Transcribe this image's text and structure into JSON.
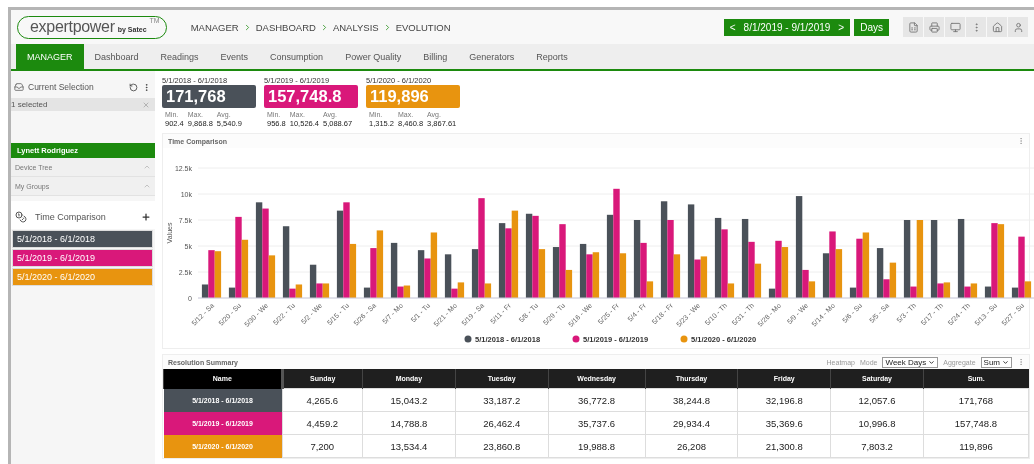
{
  "header": {
    "logo": {
      "name": "expertpower",
      "by": "by Satec",
      "tm": "TM"
    },
    "breadcrumb": [
      "MANAGER",
      "DASHBOARD",
      "ANALYSIS",
      "EVOLUTION"
    ],
    "date_range": {
      "prev": "<",
      "label": "8/1/2019 - 9/1/2019",
      "next": ">"
    },
    "resolution": "Days"
  },
  "tabs": [
    {
      "label": "MANAGER",
      "selected": true
    },
    {
      "label": "Dashboard",
      "selected": false
    },
    {
      "label": "Readings",
      "selected": false
    },
    {
      "label": "Events",
      "selected": false
    },
    {
      "label": "Consumption",
      "selected": false
    },
    {
      "label": "Power Quality",
      "selected": false
    },
    {
      "label": "Billing",
      "selected": false
    },
    {
      "label": "Generators",
      "selected": false
    },
    {
      "label": "Reports",
      "selected": false
    }
  ],
  "sidebar": {
    "current_selection": {
      "title": "Current Selection",
      "selected_text": "1 selected"
    },
    "user": "Lynett Rodriguez",
    "sections": [
      {
        "label": "Device Tree"
      },
      {
        "label": "My Groups"
      }
    ],
    "time_comparison": {
      "title": "Time Comparison",
      "periods": [
        {
          "label": "5/1/2018 - 6/1/2018",
          "color": "#4a5159"
        },
        {
          "label": "5/1/2019 - 6/1/2019",
          "color": "#d9187a"
        },
        {
          "label": "5/1/2020 - 6/1/2020",
          "color": "#e8940f"
        }
      ]
    }
  },
  "stats": [
    {
      "period": "5/1/2018 - 6/1/2018",
      "total": "171,768",
      "color": "#4a5159",
      "min_label": "Min.",
      "min": "902.4",
      "max_label": "Max.",
      "max": "9,868.8",
      "avg_label": "Avg.",
      "avg": "5,540.9"
    },
    {
      "period": "5/1/2019 - 6/1/2019",
      "total": "157,748.8",
      "color": "#d9187a",
      "min_label": "Min.",
      "min": "956.8",
      "max_label": "Max.",
      "max": "10,526.4",
      "avg_label": "Avg.",
      "avg": "5,088.67"
    },
    {
      "period": "5/1/2020 - 6/1/2020",
      "total": "119,896",
      "color": "#e8940f",
      "min_label": "Min.",
      "min": "1,315.2",
      "max_label": "Max.",
      "max": "8,460.8",
      "avg_label": "Avg.",
      "avg": "3,867.61"
    }
  ],
  "chart_panel": {
    "title": "Time Comparison",
    "chart_data": {
      "type": "bar",
      "ylabel": "Values",
      "ylim": [
        0,
        12500
      ],
      "grid": true,
      "legend": true,
      "yticks": [
        {
          "value": 0,
          "label": "0"
        },
        {
          "value": 2500,
          "label": "2.5k"
        },
        {
          "value": 5000,
          "label": "5k"
        },
        {
          "value": 7500,
          "label": "7.5k"
        },
        {
          "value": 10000,
          "label": "10k"
        },
        {
          "value": 12500,
          "label": "12.5k"
        }
      ],
      "categories": [
        "5/12 - Sa",
        "5/20 - Su",
        "5/30 - We",
        "5/22 - Tu",
        "5/2 - We",
        "5/15 - Tu",
        "5/26 - Sa",
        "5/7 - Mo",
        "5/1 - Tu",
        "5/21 - Mo",
        "5/19 - Sa",
        "5/11 - Fr",
        "5/8 - Tu",
        "5/29 - Tu",
        "5/16 - We",
        "5/25 - Fr",
        "5/4 - Fr",
        "5/18 - Fr",
        "5/23 - We",
        "5/10 - Th",
        "5/31 - Th",
        "5/28 - Mo",
        "5/9 - We",
        "5/14 - Mo",
        "5/6 - Su",
        "5/5 - Sa",
        "5/3 - Th",
        "5/17 - Th",
        "5/24 - Th",
        "5/13 - Su",
        "5/27 - Su"
      ],
      "series": [
        {
          "name": "5/1/2018 - 6/1/2018",
          "color": "#4a5159",
          "values": [
            1300,
            1000,
            9200,
            6900,
            3200,
            8400,
            1000,
            5300,
            4600,
            4200,
            4700,
            7200,
            8100,
            4900,
            5200,
            8000,
            7500,
            9300,
            9000,
            7700,
            7600,
            900,
            9800,
            4300,
            1000,
            4800,
            7500,
            7500,
            7600,
            1100,
            1000
          ]
        },
        {
          "name": "5/1/2019 - 6/1/2019",
          "color": "#d9187a",
          "values": [
            4600,
            7800,
            8600,
            900,
            1400,
            9200,
            4800,
            1100,
            3800,
            900,
            9600,
            6700,
            7900,
            7100,
            4200,
            10500,
            5300,
            7500,
            3700,
            6600,
            5400,
            5500,
            2700,
            6400,
            5700,
            1800,
            1100,
            1400,
            1100,
            7200,
            5900
          ]
        },
        {
          "name": "5/1/2020 - 6/1/2020",
          "color": "#e8940f",
          "values": [
            4500,
            5600,
            4100,
            1300,
            1400,
            5200,
            6500,
            1200,
            6300,
            1500,
            1400,
            8400,
            4700,
            2700,
            4400,
            4300,
            1600,
            4200,
            4000,
            1400,
            3300,
            4900,
            1600,
            4700,
            6300,
            3400,
            7500,
            1500,
            1400,
            7100,
            1600
          ]
        }
      ]
    }
  },
  "summary": {
    "title": "Resolution Summary",
    "heatmap": "Heatmap",
    "mode_label": "Mode",
    "mode_value": "Week Days",
    "aggregate_label": "Aggregate",
    "aggregate_value": "Sum",
    "columns": [
      "Name",
      "Sunday",
      "Monday",
      "Tuesday",
      "Wednesday",
      "Thursday",
      "Friday",
      "Saturday",
      "Sum."
    ],
    "rows": [
      {
        "color": "#4a5159",
        "cells": [
          "5/1/2018 - 6/1/2018",
          "4,265.6",
          "15,043.2",
          "33,187.2",
          "36,772.8",
          "38,244.8",
          "32,196.8",
          "12,057.6",
          "171,768"
        ]
      },
      {
        "color": "#d9187a",
        "cells": [
          "5/1/2019 - 6/1/2019",
          "4,459.2",
          "14,788.8",
          "26,462.4",
          "35,737.6",
          "29,934.4",
          "35,369.6",
          "10,996.8",
          "157,748.8"
        ]
      },
      {
        "color": "#e8940f",
        "cells": [
          "5/1/2020 - 6/1/2020",
          "7,200",
          "13,534.4",
          "23,860.8",
          "19,988.8",
          "26,208",
          "21,300.8",
          "7,803.2",
          "119,896"
        ]
      }
    ]
  }
}
